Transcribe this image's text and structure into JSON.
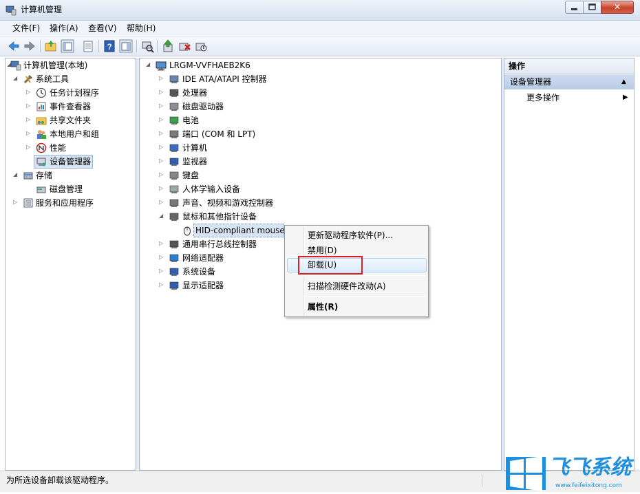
{
  "window": {
    "title": "计算机管理",
    "controls": {
      "minimize": "minimize",
      "maximize": "maximize",
      "close": "✕"
    }
  },
  "menubar": {
    "items": [
      {
        "label": "文件(F)"
      },
      {
        "label": "操作(A)"
      },
      {
        "label": "查看(V)"
      },
      {
        "label": "帮助(H)"
      }
    ]
  },
  "toolbar": {
    "icons": [
      "back-arrow-icon",
      "forward-arrow-icon",
      "up-folder-icon",
      "show-hide-tree-icon",
      "properties-icon",
      "help-icon",
      "show-hide-action-pane-icon",
      "scan-hardware-icon",
      "update-driver-icon",
      "uninstall-icon",
      "disable-icon"
    ]
  },
  "left_tree": {
    "root": "计算机管理(本地)",
    "system_tools": "系统工具",
    "task_scheduler": "任务计划程序",
    "event_viewer": "事件查看器",
    "shared_folders": "共享文件夹",
    "local_users": "本地用户和组",
    "performance": "性能",
    "device_manager": "设备管理器",
    "storage": "存储",
    "disk_management": "磁盘管理",
    "services": "服务和应用程序"
  },
  "device_tree": {
    "computer_name": "LRGM-VVFHAEB2K6",
    "categories": [
      "IDE ATA/ATAPI 控制器",
      "处理器",
      "磁盘驱动器",
      "电池",
      "端口 (COM 和 LPT)",
      "计算机",
      "监视器",
      "键盘",
      "人体学输入设备",
      "声音、视频和游戏控制器",
      "鼠标和其他指针设备",
      "通用串行总线控制器",
      "网络适配器",
      "系统设备",
      "显示适配器"
    ],
    "selected_device": "HID-compliant mouse"
  },
  "context_menu": {
    "update_driver": "更新驱动程序软件(P)...",
    "disable": "禁用(D)",
    "uninstall": "卸载(U)",
    "scan": "扫描检测硬件改动(A)",
    "properties": "属性(R)"
  },
  "actions_pane": {
    "header": "操作",
    "section": "设备管理器",
    "more_actions": "更多操作"
  },
  "statusbar": {
    "text": "为所选设备卸载该驱动程序。"
  },
  "watermark": {
    "brand": "飞飞系统",
    "url": "www.feifeixitong.com"
  },
  "colors": {
    "selection_highlight": "#dbeafb",
    "redbox": "#e02020",
    "section_bar": "#c5d5ec",
    "watermark_blue": "#1d8fe0"
  }
}
